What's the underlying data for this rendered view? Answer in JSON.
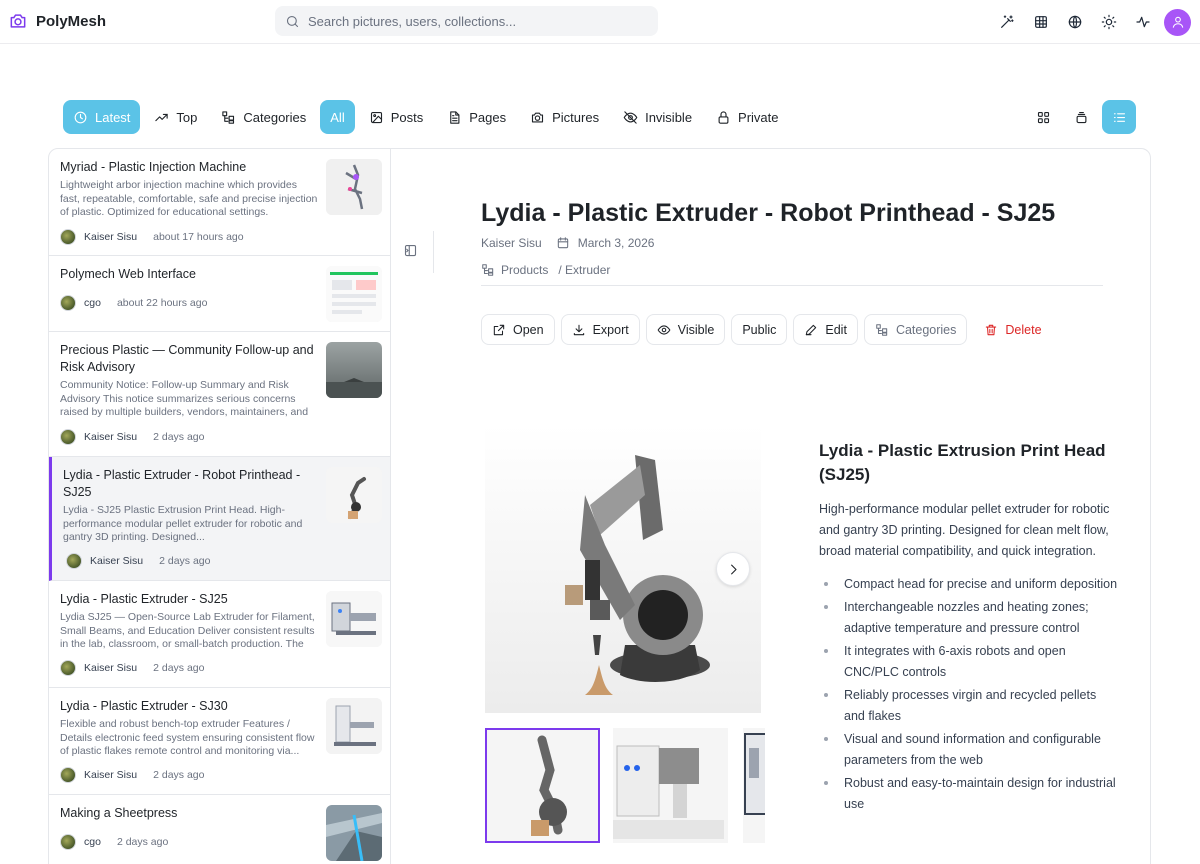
{
  "app": {
    "name": "PolyMesh"
  },
  "search": {
    "placeholder": "Search pictures, users, collections..."
  },
  "filters": [
    {
      "label": "Latest"
    },
    {
      "label": "Top"
    },
    {
      "label": "Categories"
    },
    {
      "label": "All"
    },
    {
      "label": "Posts"
    },
    {
      "label": "Pages"
    },
    {
      "label": "Pictures"
    },
    {
      "label": "Invisible"
    },
    {
      "label": "Private"
    }
  ],
  "posts": [
    {
      "title": "Myriad - Plastic Injection Machine",
      "desc": "Lightweight arbor injection machine which provides fast, repeatable, comfortable, safe and precise injection of plastic. Optimized for educational settings. Highlights...",
      "author": "Kaiser Sisu",
      "time": "about 17 hours ago"
    },
    {
      "title": "Polymech Web Interface",
      "desc": "",
      "author": "cgo",
      "time": "about 22 hours ago"
    },
    {
      "title": "Precious Plastic — Community Follow-up and Risk Advisory",
      "desc": "Community Notice: Follow-up Summary and Risk Advisory This notice summarizes serious concerns raised by multiple builders, vendors, maintainers, and investo...",
      "author": "Kaiser Sisu",
      "time": "2 days ago"
    },
    {
      "title": "Lydia - Plastic Extruder - Robot Printhead - SJ25",
      "desc": "Lydia - SJ25 Plastic Extrusion Print Head. High-performance modular pellet extruder for robotic and gantry 3D printing. Designed...",
      "author": "Kaiser Sisu",
      "time": "2 days ago"
    },
    {
      "title": "Lydia - Plastic Extruder - SJ25",
      "desc": "Lydia SJ25 — Open-Source Lab Extruder for Filament, Small Beams, and Education Deliver consistent results in the lab, classroom, or small-batch production. The Lydi...",
      "author": "Kaiser Sisu",
      "time": "2 days ago"
    },
    {
      "title": "Lydia - Plastic Extruder - SJ30",
      "desc": "Flexible and robust bench-top extruder Features / Details electronic feed system ensuring consistent flow of plastic flakes remote control and monitoring via...",
      "author": "Kaiser Sisu",
      "time": "2 days ago"
    },
    {
      "title": "Making a Sheetpress",
      "desc": "",
      "author": "cgo",
      "time": "2 days ago"
    }
  ],
  "detail": {
    "title": "Lydia - Plastic Extruder - Robot Printhead - SJ25",
    "author": "Kaiser Sisu",
    "date": "March 3, 2026",
    "category": "Products",
    "subcategory": "/ Extruder",
    "actions": [
      {
        "label": "Open"
      },
      {
        "label": "Export"
      },
      {
        "label": "Visible"
      },
      {
        "label": "Public"
      },
      {
        "label": "Edit"
      },
      {
        "label": "Categories"
      },
      {
        "label": "Delete"
      }
    ],
    "desc_title": "Lydia - Plastic Extrusion Print Head (SJ25)",
    "desc_text": "High-performance modular pellet extruder for robotic and gantry 3D printing. Designed for clean melt flow, broad material compatibility, and quick integration.",
    "features": [
      "Compact head for precise and uniform deposition",
      "Interchangeable nozzles and heating zones; adaptive temperature and pressure control",
      "It integrates with 6-axis robots and open CNC/PLC controls",
      "Reliably processes virgin and recycled pellets and flakes",
      "Visual and sound information and configurable parameters from the web",
      "Robust and easy-to-maintain design for industrial use"
    ]
  },
  "colors": {
    "accent": "#5bc3e7",
    "brand": "#7c3aed",
    "avatar": "#a855f7",
    "danger": "#dc2626"
  }
}
